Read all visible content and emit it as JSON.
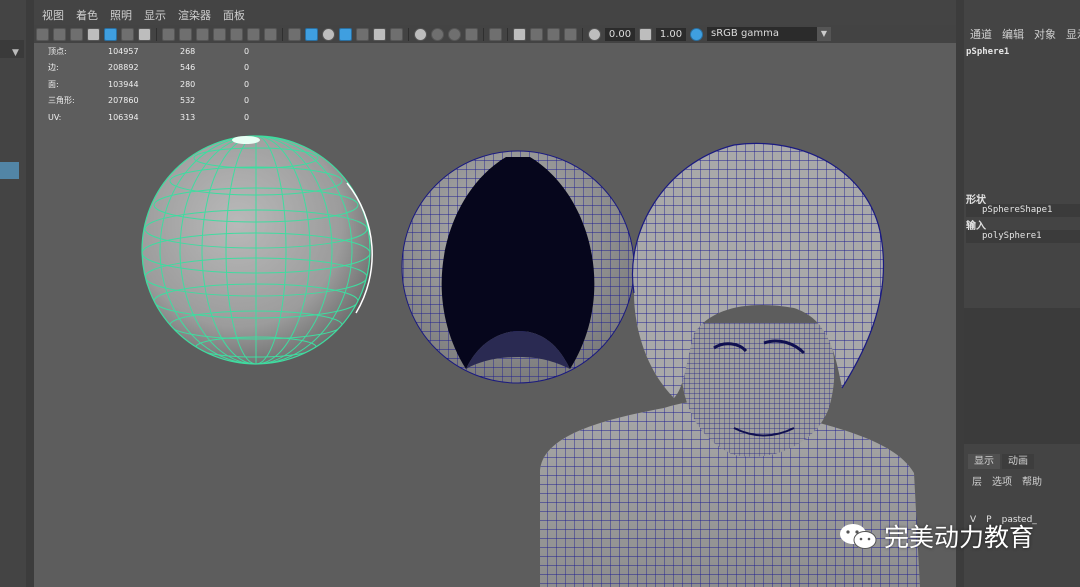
{
  "menu": [
    "视图",
    "着色",
    "照明",
    "显示",
    "渲染器",
    "面板"
  ],
  "toolbar": {
    "exposure": "0.00",
    "gamma": "1.00",
    "colorspace": "sRGB gamma"
  },
  "hud": [
    {
      "label": "顶点:",
      "v1": "104957",
      "v2": "268",
      "v3": "0"
    },
    {
      "label": "边:",
      "v1": "208892",
      "v2": "546",
      "v3": "0"
    },
    {
      "label": "面:",
      "v1": "103944",
      "v2": "280",
      "v3": "0"
    },
    {
      "label": "三角形:",
      "v1": "207860",
      "v2": "532",
      "v3": "0"
    },
    {
      "label": "UV:",
      "v1": "106394",
      "v2": "313",
      "v3": "0"
    }
  ],
  "channel": {
    "menu": [
      "通道",
      "编辑",
      "对象",
      "显示"
    ],
    "object": "pSphere1",
    "shapes_label": "形状",
    "shape": "pSphereShape1",
    "inputs_label": "输入",
    "input": "polySphere1"
  },
  "layers": {
    "tabs": [
      "显示",
      "动画"
    ],
    "menu": [
      "层",
      "选项",
      "帮助"
    ],
    "row": {
      "v": "V",
      "p": "P",
      "name": "pasted_"
    }
  },
  "watermark": "完美动力教育",
  "colors": {
    "wire_selected": "#3fdca0",
    "wire_normal": "#1a1a8a",
    "viewport_bg": "#5d5d5d",
    "highlight": "#5285a6"
  }
}
